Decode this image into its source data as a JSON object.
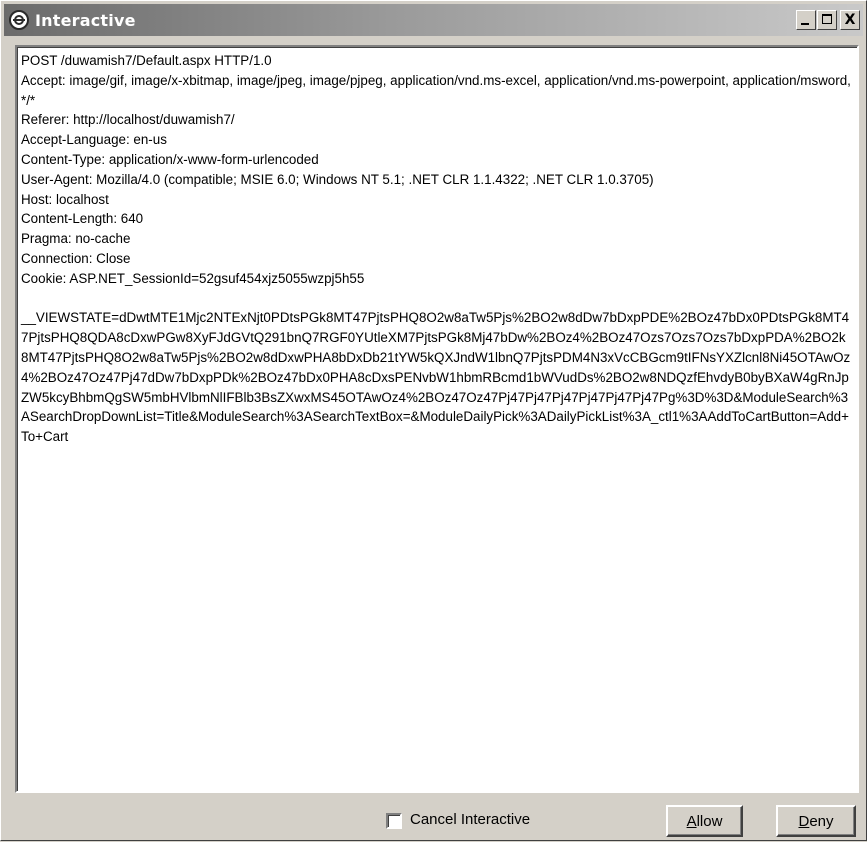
{
  "window": {
    "title": "Interactive",
    "close_glyph": "X"
  },
  "request_text": "POST /duwamish7/Default.aspx HTTP/1.0\nAccept: image/gif, image/x-xbitmap, image/jpeg, image/pjpeg, application/vnd.ms-excel, application/vnd.ms-powerpoint, application/msword, */*\nReferer: http://localhost/duwamish7/\nAccept-Language: en-us\nContent-Type: application/x-www-form-urlencoded\nUser-Agent: Mozilla/4.0 (compatible; MSIE 6.0; Windows NT 5.1; .NET CLR 1.1.4322; .NET CLR 1.0.3705)\nHost: localhost\nContent-Length: 640\nPragma: no-cache\nConnection: Close\nCookie: ASP.NET_SessionId=52gsuf454xjz5055wzpj5h55\n\n__VIEWSTATE=dDwtMTE1Mjc2NTExNjt0PDtsPGk8MT47PjtsPHQ8O2w8aTw5Pjs%2BO2w8dDw7bDxpPDE%2BOz47bDx0PDtsPGk8MT47PjtsPHQ8QDA8cDxwPGw8XyFJdGVtQ291bnQ7RGF0YUtleXM7PjtsPGk8Mj47bDw%2BOz4%2BOz47Ozs7Ozs7Ozs7bDxpPDA%2BO2k8MT47PjtsPHQ8O2w8aTw5Pjs%2BO2w8dDxwPHA8bDxDb21tYW5kQXJndW1lbnQ7PjtsPDM4N3xVcCBGcm9tIFNsYXZlcnl8Ni45OTAwOz4%2BOz47Oz47Pj47dDw7bDxpPDk%2BOz47bDx0PHA8cDxsPENvbW1hbmRBcmd1bWVudDs%2BO2w8NDQzfEhvdyB0byBXaW4gRnJpZW5kcyBhbmQgSW5mbHVlbmNlIFBlb3BsZXwxMS45OTAwOz4%2BOz47Oz47Pj47Pj47Pj47Pj47Pj47Pj47Pg%3D%3D&ModuleSearch%3ASearchDropDownList=Title&ModuleSearch%3ASearchTextBox=&ModuleDailyPick%3ADailyPickList%3A_ctl1%3AAddToCartButton=Add+To+Cart",
  "footer": {
    "cancel_interactive_label": "Cancel Interactive",
    "cancel_interactive_checked": false,
    "allow_button": {
      "accel": "A",
      "rest": "llow"
    },
    "deny_button": {
      "accel": "D",
      "rest": "eny"
    }
  },
  "colors": {
    "titlebar_start": "#6b6b6b",
    "titlebar_end": "#c9c9c9",
    "face": "#d4d0c8"
  },
  "icons": {
    "app": "globe-icon",
    "minimize": "minimize-icon",
    "maximize": "maximize-icon",
    "close": "close-icon"
  }
}
